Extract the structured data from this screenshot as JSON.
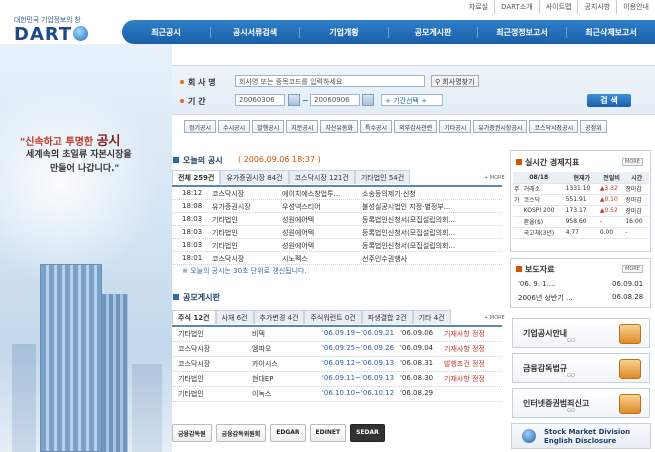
{
  "util_links": [
    "자료실",
    "DART소개",
    "사이트맵",
    "공지사항",
    "이용안내"
  ],
  "logo": {
    "small": "대한민국 기업정보의 창",
    "big": "DART"
  },
  "nav": [
    "최근공시",
    "공시서류검색",
    "기업개황",
    "공모게시판",
    "최근정정보고서",
    "최근삭제보고서"
  ],
  "hero": {
    "slogan1_pre": "\"신속하고 투명한 ",
    "slogan1_em": "공시",
    "slogan2": "세계속의 초일류 자본시장을",
    "slogan3": "만들어 나갑니다.\""
  },
  "search": {
    "company_label": "회 사 명",
    "company_placeholder": "회사명 또는 종목코드를 입력하세요",
    "company_btn": "회사명찾기",
    "period_label": "기 간",
    "date_from": "20060306",
    "date_sep": "~",
    "date_to": "20060906",
    "period_select": "+ 기간선택 +",
    "submit": "검 색"
  },
  "categories": [
    "정기공시",
    "수시공시",
    "발행공시",
    "지분공시",
    "자산유동화",
    "특수공시",
    "외부감사관련",
    "기타공시",
    "유가증권시장공시",
    "코스닥시장공시",
    "공정위"
  ],
  "today": {
    "title": "오늘의 공시",
    "datetime": "( 2006.09.06 18:37 )",
    "tabs": [
      "전체 259건",
      "유가증권시장 84건",
      "코스닥시장 121건",
      "기타법인 54건"
    ],
    "more": "+ MORE",
    "rows": [
      {
        "time": "18:12",
        "market": "코스닥시장",
        "company": "에이치에스창업투...",
        "report": "소송등의제기·신청"
      },
      {
        "time": "18:08",
        "market": "유가증권시장",
        "company": "우성넥스티어",
        "report": "불성실공시법인 지정·별정부..."
      },
      {
        "time": "18:03",
        "market": "기타법인",
        "company": "성원에어텍",
        "report": "등록법인신청서(모집설립의회..."
      },
      {
        "time": "18:03",
        "market": "기타법인",
        "company": "성원에어텍",
        "report": "등록법인신청서(모집설립의회..."
      },
      {
        "time": "18:03",
        "market": "기타법인",
        "company": "성원에어텍",
        "report": "등록법인신청서(모집설립의회..."
      },
      {
        "time": "18:01",
        "market": "코스닥시장",
        "company": "시노펙스",
        "report": "선주인수권행사"
      }
    ],
    "note": "※ 오늘의 공시는 30초 단위로 갱신됩니다."
  },
  "board": {
    "title": "공모게시판",
    "tabs": [
      "주식 12건",
      "사채 6건",
      "추가변경 4건",
      "주식워런트 0건",
      "파생결합 2건",
      "기타 4건"
    ],
    "more": "+ MORE",
    "rows": [
      {
        "market": "기타법인",
        "company": "비덱",
        "period": "'06.09.19~'06.09.21",
        "date": "'06.09.06",
        "status": "기재사항 정정"
      },
      {
        "market": "코스닥시장",
        "company": "엠파오",
        "period": "'06.09.25~'06.09.26",
        "date": "'06.09.04",
        "status": "기재사항 정정"
      },
      {
        "market": "코스닥시장",
        "company": "카이시스",
        "period": "'06.09.12~'06.09.13",
        "date": "'06.08.31",
        "status": "발행조건 정정"
      },
      {
        "market": "기타법인",
        "company": "현대EP",
        "period": "'06.09.11~'06.09.13",
        "date": "'06.08.30",
        "status": "기재사항 정정"
      },
      {
        "market": "기타법인",
        "company": "이녹스",
        "period": "'06.10.10~'06.10.12",
        "date": "'06.08.29",
        "status": ""
      }
    ]
  },
  "econ": {
    "title": "실시간 경제지표",
    "more": "MORE",
    "headers": [
      "08/18",
      "현재가",
      "전일비",
      "시간"
    ],
    "rows": [
      {
        "group": "주",
        "name": "거래소",
        "price": "1331.10",
        "dir": "up",
        "change": "3.32",
        "time": "장마감"
      },
      {
        "group": "가",
        "name": "코스닥",
        "price": "551.91",
        "dir": "up",
        "change": "0.10",
        "time": "장마감"
      },
      {
        "group": "",
        "name": "KOSPI 200",
        "price": "173.17",
        "dir": "up",
        "change": "0.52",
        "time": "장마감"
      },
      {
        "group": "",
        "name": "환율($)",
        "price": "958.60",
        "dir": "",
        "change": "-",
        "time": "16:00"
      },
      {
        "group": "",
        "name": "국고채(3년)",
        "price": "4.77",
        "dir": "",
        "change": "0.00",
        "time": "-"
      }
    ]
  },
  "press": {
    "title": "보도자료",
    "more": "MORE",
    "rows": [
      {
        "title": "'06. 9. 1....",
        "date": "06.09.01"
      },
      {
        "title": "2006년 상반기 ...",
        "date": "06.08.28"
      }
    ]
  },
  "side_links": [
    {
      "label": "기업공시안내",
      "go": "GO"
    },
    {
      "label": "금융감독법규",
      "go": "GO"
    },
    {
      "label": "인터넷증권범죄신고",
      "go": "GO"
    }
  ],
  "footer_logos": [
    "금융감독원",
    "금융감독위원회",
    "EDGAR",
    "EDINET",
    "SEDAR"
  ],
  "english": {
    "line1": "Stock Market Division",
    "line2": "English Disclosure"
  }
}
